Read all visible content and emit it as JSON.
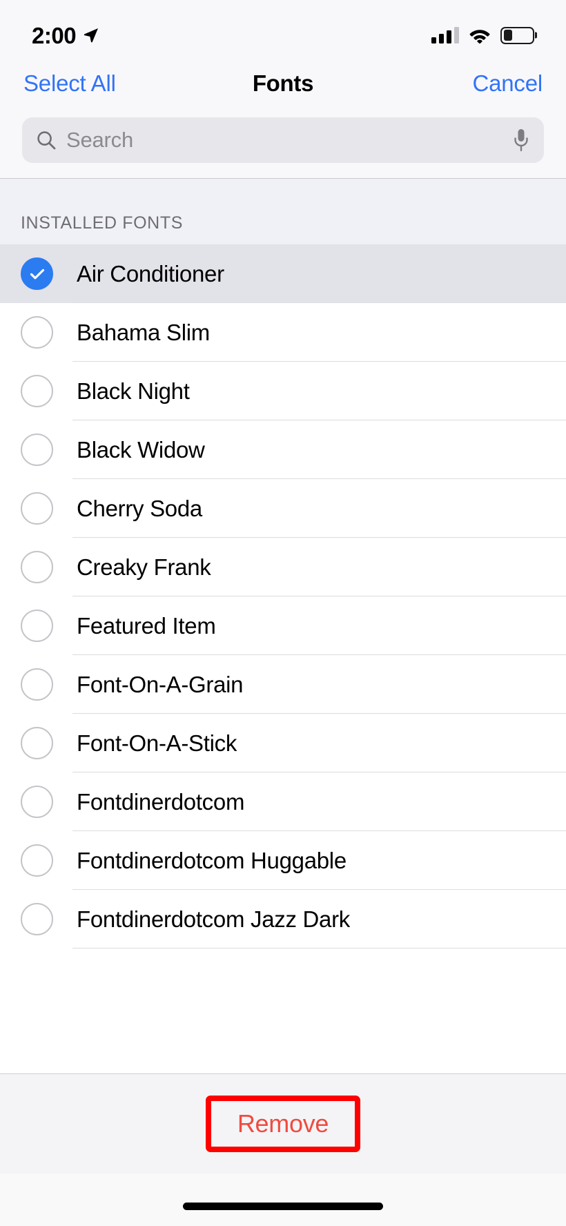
{
  "status_bar": {
    "time": "2:00",
    "location_icon": "location-arrow-icon",
    "cellular_icon": "cellular-bars-icon",
    "wifi_icon": "wifi-icon",
    "battery_icon": "battery-icon",
    "battery_level_percent": 32
  },
  "nav": {
    "left_button": "Select All",
    "title": "Fonts",
    "right_button": "Cancel",
    "accent_color": "#3273f6"
  },
  "search": {
    "placeholder": "Search",
    "value": "",
    "search_icon": "search-icon",
    "mic_icon": "microphone-icon"
  },
  "list": {
    "section_header": "INSTALLED FONTS",
    "rows": [
      {
        "label": "Air Conditioner",
        "selected": true
      },
      {
        "label": "Bahama Slim",
        "selected": false
      },
      {
        "label": "Black Night",
        "selected": false
      },
      {
        "label": "Black Widow",
        "selected": false
      },
      {
        "label": "Cherry Soda",
        "selected": false
      },
      {
        "label": "Creaky Frank",
        "selected": false
      },
      {
        "label": "Featured Item",
        "selected": false
      },
      {
        "label": "Font-On-A-Grain",
        "selected": false
      },
      {
        "label": "Font-On-A-Stick",
        "selected": false
      },
      {
        "label": "Fontdinerdotcom",
        "selected": false
      },
      {
        "label": "Fontdinerdotcom Huggable",
        "selected": false
      },
      {
        "label": "Fontdinerdotcom Jazz Dark",
        "selected": false
      }
    ]
  },
  "bottom_bar": {
    "remove_label": "Remove",
    "remove_color": "#ef4b41",
    "annotation_color": "#fe0000"
  },
  "home_indicator": "home-indicator"
}
